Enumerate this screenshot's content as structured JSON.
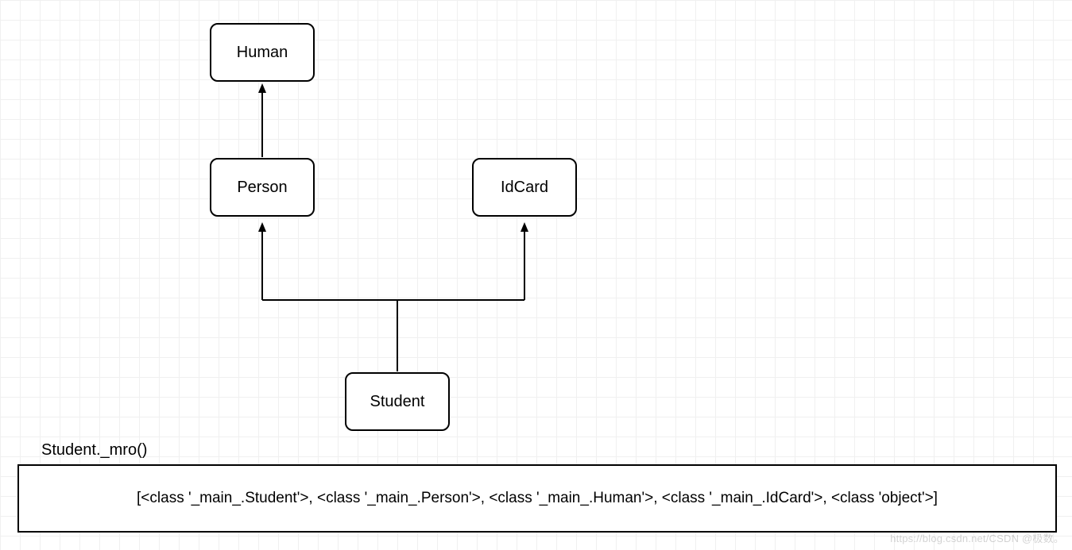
{
  "diagram": {
    "nodes": {
      "human": {
        "label": "Human"
      },
      "person": {
        "label": "Person"
      },
      "idcard": {
        "label": "IdCard"
      },
      "student": {
        "label": "Student"
      }
    },
    "mro": {
      "label": "Student._mro()",
      "output": "[<class '_main_.Student'>, <class '_main_.Person'>, <class '_main_.Human'>, <class '_main_.IdCard'>, <class 'object'>]"
    }
  },
  "watermark": "https://blog.csdn.net/CSDN @极数。"
}
